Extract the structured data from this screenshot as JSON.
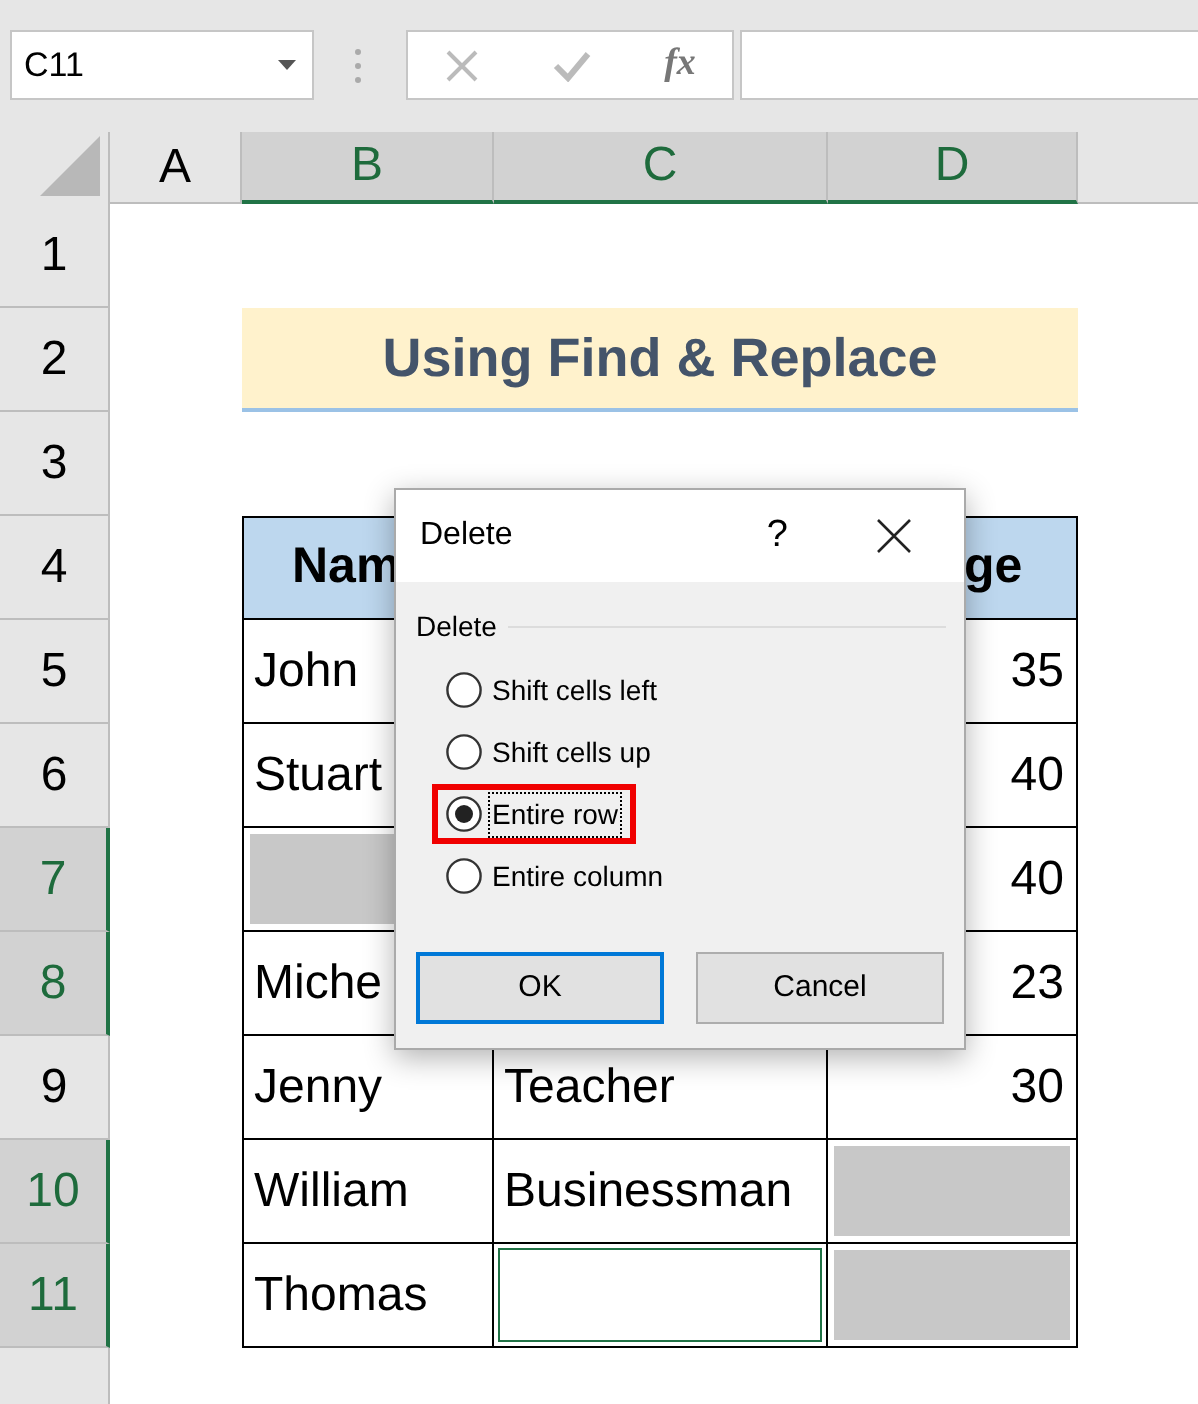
{
  "name_box": {
    "value": "C11"
  },
  "formula_bar": {
    "fx_label": "fx"
  },
  "columns": [
    {
      "label": "A",
      "selected": false
    },
    {
      "label": "B",
      "selected": true
    },
    {
      "label": "C",
      "selected": true
    },
    {
      "label": "D",
      "selected": true
    }
  ],
  "rows": [
    {
      "label": "1",
      "selected": false
    },
    {
      "label": "2",
      "selected": false
    },
    {
      "label": "3",
      "selected": false
    },
    {
      "label": "4",
      "selected": false
    },
    {
      "label": "5",
      "selected": false
    },
    {
      "label": "6",
      "selected": false
    },
    {
      "label": "7",
      "selected": true
    },
    {
      "label": "8",
      "selected": true
    },
    {
      "label": "9",
      "selected": false
    },
    {
      "label": "10",
      "selected": true
    },
    {
      "label": "11",
      "selected": true
    }
  ],
  "title": "Using Find & Replace",
  "table": {
    "header": [
      {
        "text": "Nam"
      },
      {
        "text": "ge"
      }
    ],
    "rows": [
      [
        {
          "text": "John",
          "highlighted": false,
          "selected": false
        },
        null,
        {
          "text": "35",
          "highlighted": false,
          "selected": false
        }
      ],
      [
        {
          "text": "Stuart",
          "highlighted": false,
          "selected": false
        },
        null,
        {
          "text": "40",
          "highlighted": false,
          "selected": false
        }
      ],
      [
        {
          "highlighted": true,
          "selected": false
        },
        null,
        {
          "text": "40",
          "highlighted": false,
          "selected": false
        }
      ],
      [
        {
          "text": "Miche",
          "highlighted": false,
          "selected": false
        },
        null,
        {
          "text": "23",
          "highlighted": false,
          "selected": false
        }
      ],
      [
        {
          "text": "Jenny",
          "highlighted": false,
          "selected": false
        },
        {
          "text": "Teacher",
          "highlighted": false,
          "selected": false
        },
        {
          "text": "30",
          "highlighted": false,
          "selected": false
        }
      ],
      [
        {
          "text": "William",
          "highlighted": false,
          "selected": false
        },
        {
          "text": "Businessman",
          "highlighted": false,
          "selected": false
        },
        {
          "highlighted": true,
          "selected": false
        }
      ],
      [
        {
          "text": "Thomas",
          "highlighted": false,
          "selected": false
        },
        {
          "highlighted": false,
          "selected": true
        },
        {
          "highlighted": true,
          "selected": false
        }
      ]
    ]
  },
  "dialog": {
    "title": "Delete",
    "help": "?",
    "group_label": "Delete",
    "options": [
      {
        "label": "Shift cells left",
        "selected": false,
        "annotated": false
      },
      {
        "label": "Shift cells up",
        "selected": false,
        "annotated": false
      },
      {
        "label": "Entire row",
        "selected": true,
        "annotated": true
      },
      {
        "label": "Entire column",
        "selected": false,
        "annotated": false
      }
    ],
    "buttons": [
      {
        "label": "OK",
        "default": true
      },
      {
        "label": "Cancel",
        "default": false
      }
    ]
  }
}
